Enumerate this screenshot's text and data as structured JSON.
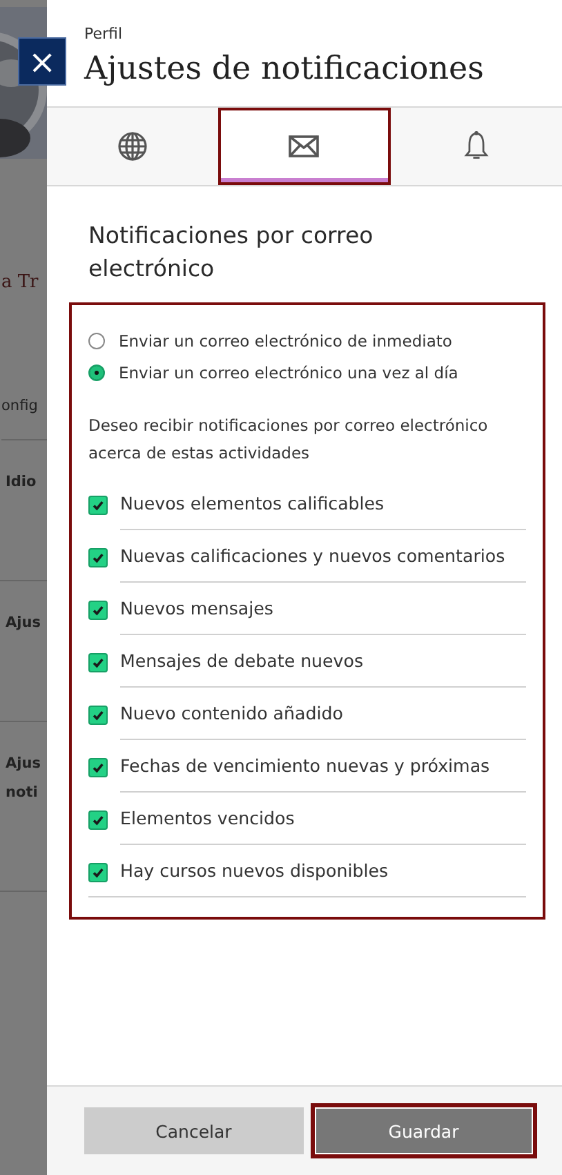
{
  "background": {
    "heading": "a Tr",
    "section": "onfig",
    "rows": [
      [
        "Idio"
      ],
      [
        "Ajus"
      ],
      [
        "Ajus",
        "noti"
      ]
    ]
  },
  "close_button": {
    "label": "×"
  },
  "panel": {
    "eyebrow": "Perfil",
    "title": "Ajustes de notificaciones"
  },
  "tabs": [
    {
      "selected": false,
      "highlighted": false
    },
    {
      "selected": true,
      "highlighted": true
    },
    {
      "selected": false,
      "highlighted": false
    }
  ],
  "section": {
    "title": "Notificaciones por correo electrónico",
    "highlighted": true
  },
  "frequency": [
    {
      "label": "Enviar un correo electrónico de inmediato",
      "selected": false
    },
    {
      "label": "Enviar un correo electrónico una vez al día",
      "selected": true
    }
  ],
  "activities_intro": "Deseo recibir notificaciones por correo electrónico acerca de estas actividades",
  "activities": [
    {
      "label": "Nuevos elementos calificables",
      "checked": true
    },
    {
      "label": "Nuevas calificaciones y nuevos comentarios",
      "checked": true
    },
    {
      "label": "Nuevos mensajes",
      "checked": true
    },
    {
      "label": "Mensajes de debate nuevos",
      "checked": true
    },
    {
      "label": "Nuevo contenido añadido",
      "checked": true
    },
    {
      "label": "Fechas de vencimiento nuevas y próximas",
      "checked": true
    },
    {
      "label": "Elementos vencidos",
      "checked": true
    },
    {
      "label": "Hay cursos nuevos disponibles",
      "checked": true
    }
  ],
  "buttons": [
    {
      "label": "Cancelar",
      "kind": "secondary",
      "highlighted": false
    },
    {
      "label": "Guardar",
      "kind": "primary",
      "highlighted": true
    }
  ]
}
